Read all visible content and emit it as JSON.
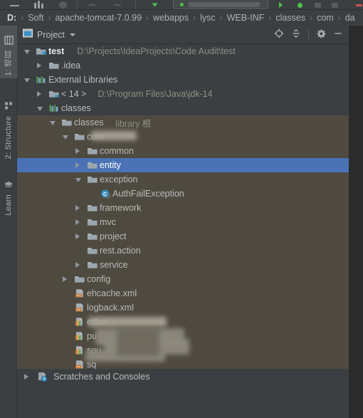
{
  "window": {
    "background_color": "#3C3F41",
    "selection_color": "#4A72B5",
    "library_band_color": "#4F4A40"
  },
  "breadcrumb": {
    "name": "file-path-breadcrumb",
    "separator": "›",
    "crumbs": [
      "D:",
      "Soft",
      "apache-tomcat-7.0.99",
      "webapps",
      "lysc",
      "WEB-INF",
      "classes",
      "com",
      "da"
    ]
  },
  "left_tool_strip": {
    "buttons": [
      {
        "label": "1: 项目",
        "icon": "project-icon",
        "active": true
      },
      {
        "label": "2: Structure",
        "icon": "structure-icon",
        "active": false
      },
      {
        "label": "Learn",
        "icon": "graduation-cap-icon",
        "active": false
      }
    ]
  },
  "panel": {
    "title": "Project",
    "title_icon": "project-window-icon",
    "dropdown_icon": "chevron-down-icon",
    "actions": [
      {
        "name": "select-opened-file-button",
        "icon": "locate-target-icon"
      },
      {
        "name": "collapse-all-button",
        "icon": "collapse-all-icon"
      },
      {
        "name": "settings-button",
        "icon": "gear-icon"
      },
      {
        "name": "hide-button",
        "icon": "minimize-icon"
      }
    ]
  },
  "tree": {
    "nodes": [
      {
        "id": "test",
        "label": "test",
        "sublabel": "D:\\Projects\\IdeaProjects\\Code Audit\\test",
        "indent": 0,
        "state": "expanded",
        "icon": "module-folder-icon",
        "bold": true,
        "selected": false
      },
      {
        "id": "idea",
        "label": ".idea",
        "sublabel": "",
        "indent": 1,
        "state": "collapsed",
        "icon": "folder-icon",
        "bold": false,
        "selected": false
      },
      {
        "id": "external-libraries",
        "label": "External Libraries",
        "sublabel": "",
        "indent": 0,
        "state": "expanded",
        "icon": "libraries-icon",
        "bold": false,
        "selected": false
      },
      {
        "id": "jdk",
        "label": "< 14 >",
        "sublabel": "D:\\Program Files\\Java\\jdk-14",
        "indent": 1,
        "state": "collapsed",
        "icon": "jdk-library-icon",
        "bold": false,
        "selected": false
      },
      {
        "id": "classes-lib",
        "label": "classes",
        "sublabel": "",
        "indent": 1,
        "state": "expanded",
        "icon": "library-icon",
        "bold": false,
        "selected": false
      },
      {
        "id": "classes-root",
        "label": "classes",
        "sublabel": "library 根",
        "indent": 2,
        "state": "expanded",
        "icon": "folder-icon",
        "bold": false,
        "selected": false
      },
      {
        "id": "com",
        "label": "com",
        "sublabel": "",
        "indent": 3,
        "state": "expanded",
        "icon": "folder-icon",
        "bold": false,
        "selected": false,
        "redacted": true
      },
      {
        "id": "common",
        "label": "common",
        "sublabel": "",
        "indent": 4,
        "state": "collapsed",
        "icon": "folder-icon",
        "bold": false,
        "selected": false
      },
      {
        "id": "entity",
        "label": "entity",
        "sublabel": "",
        "indent": 4,
        "state": "collapsed",
        "icon": "folder-icon",
        "bold": false,
        "selected": true
      },
      {
        "id": "exception",
        "label": "exception",
        "sublabel": "",
        "indent": 4,
        "state": "expanded",
        "icon": "folder-icon",
        "bold": false,
        "selected": false
      },
      {
        "id": "authfailexception",
        "label": "AuthFailException",
        "sublabel": "",
        "indent": 5,
        "state": "leaf",
        "icon": "class-icon",
        "bold": false,
        "selected": false
      },
      {
        "id": "framework",
        "label": "framework",
        "sublabel": "",
        "indent": 4,
        "state": "collapsed",
        "icon": "folder-icon",
        "bold": false,
        "selected": false
      },
      {
        "id": "mvc",
        "label": "mvc",
        "sublabel": "",
        "indent": 4,
        "state": "collapsed",
        "icon": "folder-icon",
        "bold": false,
        "selected": false
      },
      {
        "id": "project",
        "label": "project",
        "sublabel": "",
        "indent": 4,
        "state": "collapsed",
        "icon": "folder-icon",
        "bold": false,
        "selected": false
      },
      {
        "id": "rest-action",
        "label": "rest.action",
        "sublabel": "",
        "indent": 4,
        "state": "leaf",
        "icon": "folder-icon",
        "bold": false,
        "selected": false
      },
      {
        "id": "service",
        "label": "service",
        "sublabel": "",
        "indent": 4,
        "state": "collapsed",
        "icon": "folder-icon",
        "bold": false,
        "selected": false
      },
      {
        "id": "config",
        "label": "config",
        "sublabel": "",
        "indent": 3,
        "state": "collapsed",
        "icon": "folder-icon",
        "bold": false,
        "selected": false
      },
      {
        "id": "ehcache-xml",
        "label": "ehcache.xml",
        "sublabel": "",
        "indent": 3,
        "state": "leaf",
        "icon": "xml-file-icon",
        "bold": false,
        "selected": false
      },
      {
        "id": "logback-xml",
        "label": "logback.xml",
        "sublabel": "",
        "indent": 3,
        "state": "leaf",
        "icon": "xml-file-icon",
        "bold": false,
        "selected": false
      },
      {
        "id": "properties-1",
        "label": "erties",
        "sublabel": "",
        "indent": 3,
        "state": "leaf",
        "icon": "properties-file-icon",
        "bold": false,
        "selected": false,
        "redacted": true
      },
      {
        "id": "properties-2",
        "label": "pu",
        "sublabel": "",
        "indent": 3,
        "state": "leaf",
        "icon": "properties-file-icon",
        "bold": false,
        "selected": false,
        "redacted": true
      },
      {
        "id": "properties-3",
        "label": "sou",
        "sublabel": "",
        "indent": 3,
        "state": "leaf",
        "icon": "properties-file-icon",
        "bold": false,
        "selected": false,
        "redacted": true
      },
      {
        "id": "sql-xml",
        "label": "sq",
        "sublabel": "",
        "indent": 3,
        "state": "leaf",
        "icon": "xml-file-icon",
        "bold": false,
        "selected": false,
        "redacted": true
      }
    ],
    "bottom_node": {
      "label": "Scratches and Consoles",
      "icon": "scratches-icon",
      "state": "collapsed"
    }
  }
}
